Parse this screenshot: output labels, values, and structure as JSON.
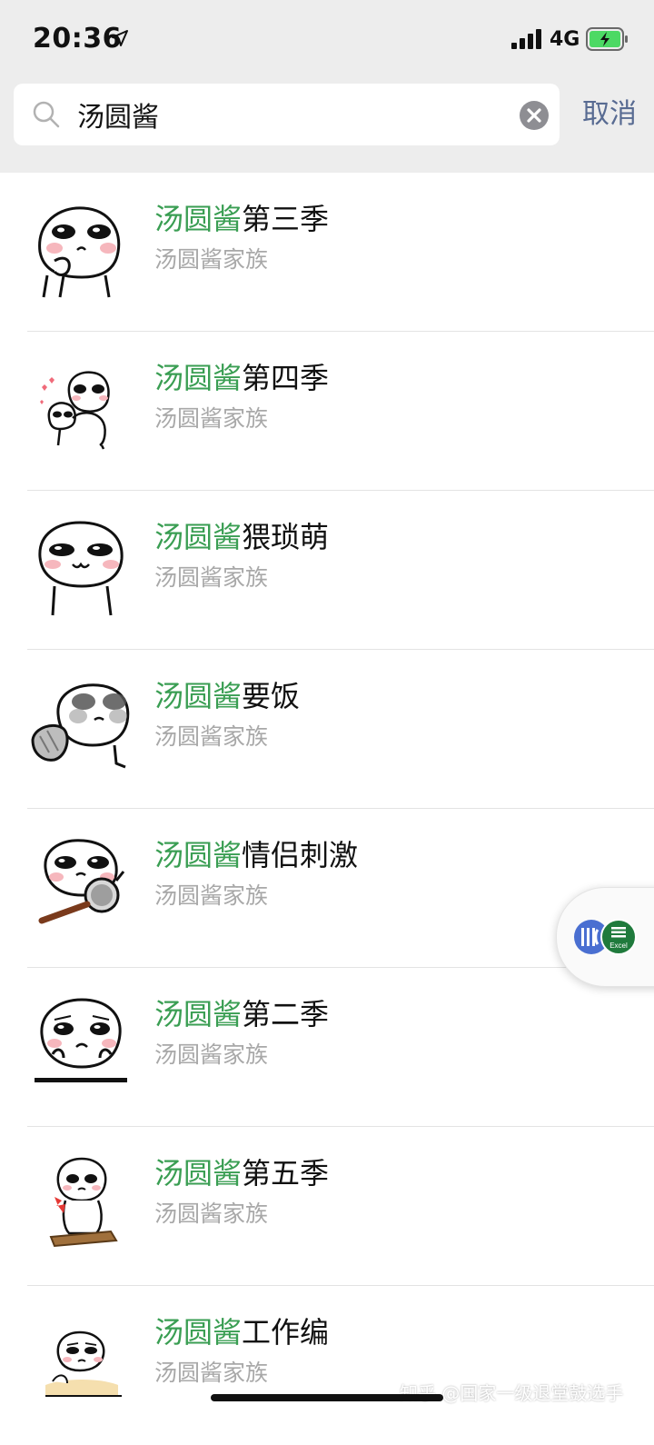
{
  "status_bar": {
    "time": "20:36",
    "network": "4G"
  },
  "search": {
    "query": "汤圆酱",
    "cancel_label": "取消"
  },
  "results": [
    {
      "highlight": "汤圆酱",
      "rest": "第三季",
      "subtitle": "汤圆酱家族",
      "sticker": "sticker-thinking"
    },
    {
      "highlight": "汤圆酱",
      "rest": "第四季",
      "subtitle": "汤圆酱家族",
      "sticker": "sticker-hug-hearts"
    },
    {
      "highlight": "汤圆酱",
      "rest": "猥琐萌",
      "subtitle": "汤圆酱家族",
      "sticker": "sticker-smug"
    },
    {
      "highlight": "汤圆酱",
      "rest": "要饭",
      "subtitle": "汤圆酱家族",
      "sticker": "sticker-begging-bowl"
    },
    {
      "highlight": "汤圆酱",
      "rest": "情侣刺激",
      "subtitle": "汤圆酱家族",
      "sticker": "sticker-frying-pan"
    },
    {
      "highlight": "汤圆酱",
      "rest": "第二季",
      "subtitle": "汤圆酱家族",
      "sticker": "sticker-sad-chin"
    },
    {
      "highlight": "汤圆酱",
      "rest": "第五季",
      "subtitle": "汤圆酱家族",
      "sticker": "sticker-sitting-board"
    },
    {
      "highlight": "汤圆酱",
      "rest": "工作编",
      "subtitle": "汤圆酱家族",
      "sticker": "sticker-lying-down"
    }
  ],
  "floating_widget": {
    "badge_label": "Excel"
  },
  "watermark": "知乎 @国家一级退堂鼓选手",
  "colors": {
    "highlight": "#3a9e53",
    "subtitle": "#a8a8a8",
    "cancel": "#586b92",
    "topbar": "#ededed"
  }
}
